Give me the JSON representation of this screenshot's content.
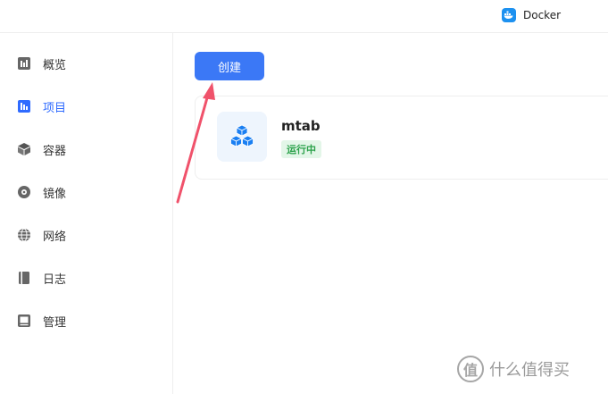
{
  "topbar": {
    "app_name": "Docker",
    "app_icon": "docker-whale-icon"
  },
  "sidebar": {
    "items": [
      {
        "label": "概览",
        "icon": "overview-icon",
        "active": false
      },
      {
        "label": "项目",
        "icon": "project-icon",
        "active": true
      },
      {
        "label": "容器",
        "icon": "container-icon",
        "active": false
      },
      {
        "label": "镜像",
        "icon": "image-icon",
        "active": false
      },
      {
        "label": "网络",
        "icon": "globe-icon",
        "active": false
      },
      {
        "label": "日志",
        "icon": "log-icon",
        "active": false
      },
      {
        "label": "管理",
        "icon": "manage-icon",
        "active": false
      }
    ]
  },
  "main": {
    "create_label": "创建",
    "project": {
      "name": "mtab",
      "status": "运行中",
      "icon": "cubes-icon"
    }
  },
  "watermark": {
    "text": "什么值得买",
    "logo_char": "值"
  },
  "colors": {
    "accent": "#3b78f6",
    "active_nav": "#2f6bff",
    "status_green": "#2ba14a",
    "status_bg": "#e3f6e8",
    "arrow": "#f0526b"
  }
}
